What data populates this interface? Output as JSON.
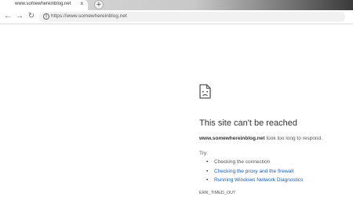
{
  "browser": {
    "tab": {
      "title": "www.somewhereinblog.net",
      "close": "×"
    },
    "new_tab": "+",
    "toolbar": {
      "back": "←",
      "forward": "→",
      "reload": "↻",
      "info": "i",
      "url": "https://www.somewhereinblog.net"
    }
  },
  "error": {
    "icon": "sad-page-icon",
    "title": "This site can't be reached",
    "host": "www.somewhereinblog.net",
    "message": " took too long to respond.",
    "try_label": "Try:",
    "suggestions": [
      {
        "label": "Checking the connection",
        "link": false
      },
      {
        "label": "Checking the proxy and the firewall",
        "link": true
      },
      {
        "label": "Running Windows Network Diagnostics",
        "link": true
      }
    ],
    "code": "ERR_TIMED_OUT"
  },
  "colors": {
    "link": "#1a5fb4",
    "title": "#333333",
    "text": "#555555"
  }
}
